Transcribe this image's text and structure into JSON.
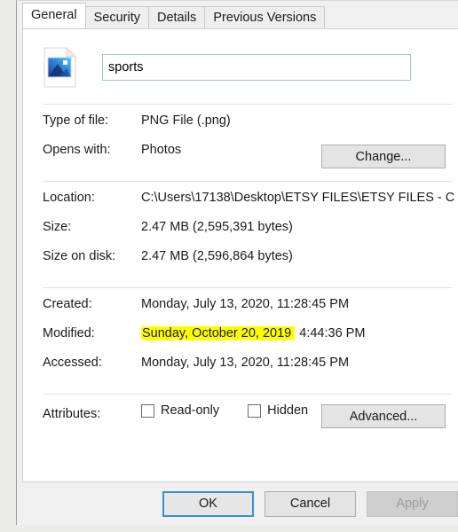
{
  "window": {
    "tabs": [
      {
        "label": "General",
        "active": true
      },
      {
        "label": "Security",
        "active": false
      },
      {
        "label": "Details",
        "active": false
      },
      {
        "label": "Previous Versions",
        "active": false
      }
    ]
  },
  "file": {
    "icon": "png-image-file-icon",
    "name_value": "sports",
    "name_placeholder": ""
  },
  "properties": {
    "type_of_file_label": "Type of file:",
    "type_of_file_value": "PNG File (.png)",
    "opens_with_label": "Opens with:",
    "opens_with_value": "Photos",
    "change_button": "Change...",
    "location_label": "Location:",
    "location_value": "C:\\Users\\17138\\Desktop\\ETSY FILES\\ETSY FILES - C",
    "size_label": "Size:",
    "size_value": "2.47 MB (2,595,391 bytes)",
    "size_on_disk_label": "Size on disk:",
    "size_on_disk_value": "2.47 MB (2,596,864 bytes)",
    "created_label": "Created:",
    "created_value": "Monday, July 13, 2020, 11:28:45 PM",
    "modified_label": "Modified:",
    "modified_value_highlighted": "Sunday, October 20, 2019",
    "modified_value_rest": ", 4:44:36 PM",
    "accessed_label": "Accessed:",
    "accessed_value": "Monday, July 13, 2020, 11:28:45 PM",
    "attributes_label": "Attributes:",
    "read_only_label": "Read-only",
    "read_only_checked": false,
    "hidden_label": "Hidden",
    "hidden_checked": false,
    "advanced_button": "Advanced..."
  },
  "footer": {
    "ok_label": "OK",
    "cancel_label": "Cancel",
    "apply_label": "Apply",
    "apply_disabled": true
  },
  "colors": {
    "highlight": "#FFFF00",
    "focus_border": "#3A8ED0",
    "input_border": "#9CC4E4",
    "dialog_bg": "#F0F0F0",
    "panel_bg": "#FFFFFF",
    "disabled_text": "#9A9A9A"
  }
}
